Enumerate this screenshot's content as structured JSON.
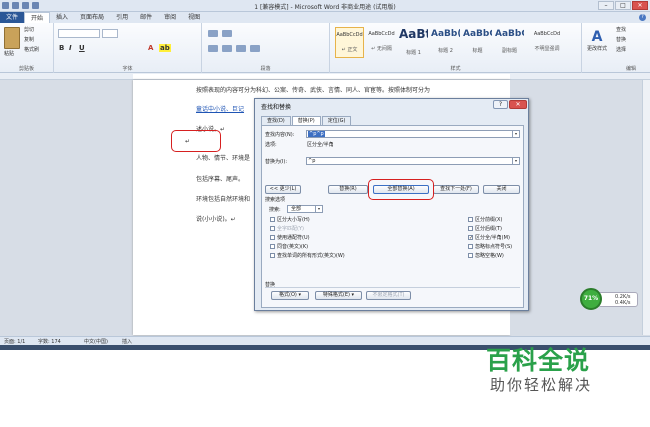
{
  "window": {
    "title": "1 [兼容模式] - Microsoft Word 非商业用途 (试用版)"
  },
  "ribbon_tabs": [
    "文件",
    "开始",
    "插入",
    "页面布局",
    "引用",
    "邮件",
    "审阅",
    "视图"
  ],
  "clipboard": {
    "paste": "粘贴",
    "cut": "剪切",
    "copy": "复制",
    "format_painter": "格式刷",
    "label": "剪贴板"
  },
  "font": {
    "label": "字体"
  },
  "paragraph": {
    "label": "段落"
  },
  "styles": {
    "label": "样式",
    "items": [
      {
        "preview": "AaBbCcDd",
        "name": "↵ 正文"
      },
      {
        "preview": "AaBbCcDd",
        "name": "↵ 无间隔"
      },
      {
        "preview": "AaBt",
        "name": "标题 1"
      },
      {
        "preview": "AaBb(",
        "name": "标题 2"
      },
      {
        "preview": "AaBbC",
        "name": "标题"
      },
      {
        "preview": "AaBbC",
        "name": "副标题"
      },
      {
        "preview": "AaBbCcDd",
        "name": "不明显强调"
      }
    ],
    "change_styles": "更改样式"
  },
  "editing": {
    "find": "查找",
    "replace": "替换",
    "select": "选择",
    "label": "编辑"
  },
  "document": {
    "lines": [
      "按照表现的内容可分为科幻、公案、传奇、武侠、言情、同人、官宦等。按照体制可分为",
      "童话中小说、巨记",
      "述小说。↵",
      "↵",
      "人物、情节、环境是",
      "包括序幕、尾声。",
      "环境包括自然环境和",
      "说(小小说)。↵"
    ]
  },
  "dialog": {
    "title": "查找和替换",
    "help": "?",
    "close": "✕",
    "tabs": [
      "查找(D)",
      "替换(P)",
      "定位(G)"
    ],
    "find_label": "查找内容(N):",
    "find_value": "^p^p",
    "options_label": "选项:",
    "options_value": "区分全/半角",
    "replace_label": "替换为(I):",
    "replace_value": "^p",
    "buttons": {
      "less": "<< 更少(L)",
      "replace": "替换(R)",
      "replace_all": "全部替换(A)",
      "find_next": "查找下一处(F)",
      "cancel": "关闭"
    },
    "search_options_title": "搜索选项",
    "search_label": "搜索:",
    "search_value": "全部",
    "left_checks": [
      {
        "label": "区分大小写(H)",
        "checked": false,
        "enabled": true
      },
      {
        "label": "全字匹配(Y)",
        "checked": false,
        "enabled": false
      },
      {
        "label": "使用通配符(U)",
        "checked": false,
        "enabled": true
      },
      {
        "label": "同音(英文)(K)",
        "checked": false,
        "enabled": true
      },
      {
        "label": "查找单词的所有形式(英文)(W)",
        "checked": false,
        "enabled": true
      }
    ],
    "right_checks": [
      {
        "label": "区分前缀(X)",
        "checked": false,
        "enabled": true
      },
      {
        "label": "区分后缀(T)",
        "checked": false,
        "enabled": true
      },
      {
        "label": "区分全/半角(M)",
        "checked": true,
        "enabled": true
      },
      {
        "label": "忽略标点符号(S)",
        "checked": false,
        "enabled": true
      },
      {
        "label": "忽略空格(W)",
        "checked": false,
        "enabled": true
      }
    ],
    "find_section_title": "替换",
    "bottom_buttons": {
      "format": "格式(O) ▾",
      "special": "特殊格式(E) ▾",
      "no_format": "不限定格式(T)"
    }
  },
  "status_bar": {
    "page": "页面: 1/1",
    "words": "字数: 174",
    "language": "中文(中国)",
    "mode": "插入"
  },
  "widget": {
    "percent": "71%",
    "up": "0.2K/s",
    "down": "0.4K/s"
  },
  "watermark": {
    "logo": "百科全说",
    "sub": "助你轻松解决"
  },
  "colors": {
    "accent": "#2b5797",
    "highlight_red": "#d62020",
    "watermark_green": "#2aa14a"
  }
}
